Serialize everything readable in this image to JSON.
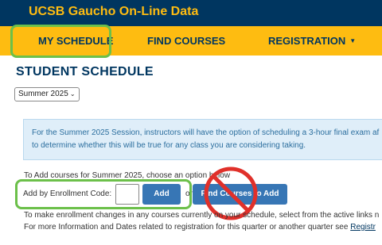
{
  "header": {
    "brand": "UCSB Gaucho On-Line Data"
  },
  "nav": {
    "my_schedule": "MY SCHEDULE",
    "find_courses": "FIND COURSES",
    "registration": "REGISTRATION"
  },
  "page": {
    "title": "STUDENT SCHEDULE",
    "term_selected": "Summer 2025"
  },
  "info_box": {
    "line1": "For the Summer 2025 Session, instructors will have the option of scheduling a 3-hour final exam af",
    "line2": "to determine whether this will be true for any class you are considering taking."
  },
  "add_courses": {
    "intro": "To Add courses for Summer 2025, choose an option below",
    "enroll_label": "Add by Enrollment Code:",
    "enroll_value": "",
    "add_button": "Add",
    "or_text": "or",
    "find_button": "Find Courses to Add"
  },
  "notes": {
    "line1": "To make enrollment changes in any courses currently on your schedule, select from the active links n",
    "line2_text": "For more Information and Dates related to registration for this quarter or another quarter see ",
    "line2_link": "Registr"
  },
  "colors": {
    "brand_navy": "#003660",
    "brand_gold": "#febc11",
    "button_blue": "#3776b5",
    "highlight_green": "#6cc04a",
    "prohibit_red": "#e0302a",
    "info_bg": "#dfeef9"
  },
  "icons": {
    "caret": "chevron-down-icon",
    "prohibited": "no-symbol-icon"
  }
}
